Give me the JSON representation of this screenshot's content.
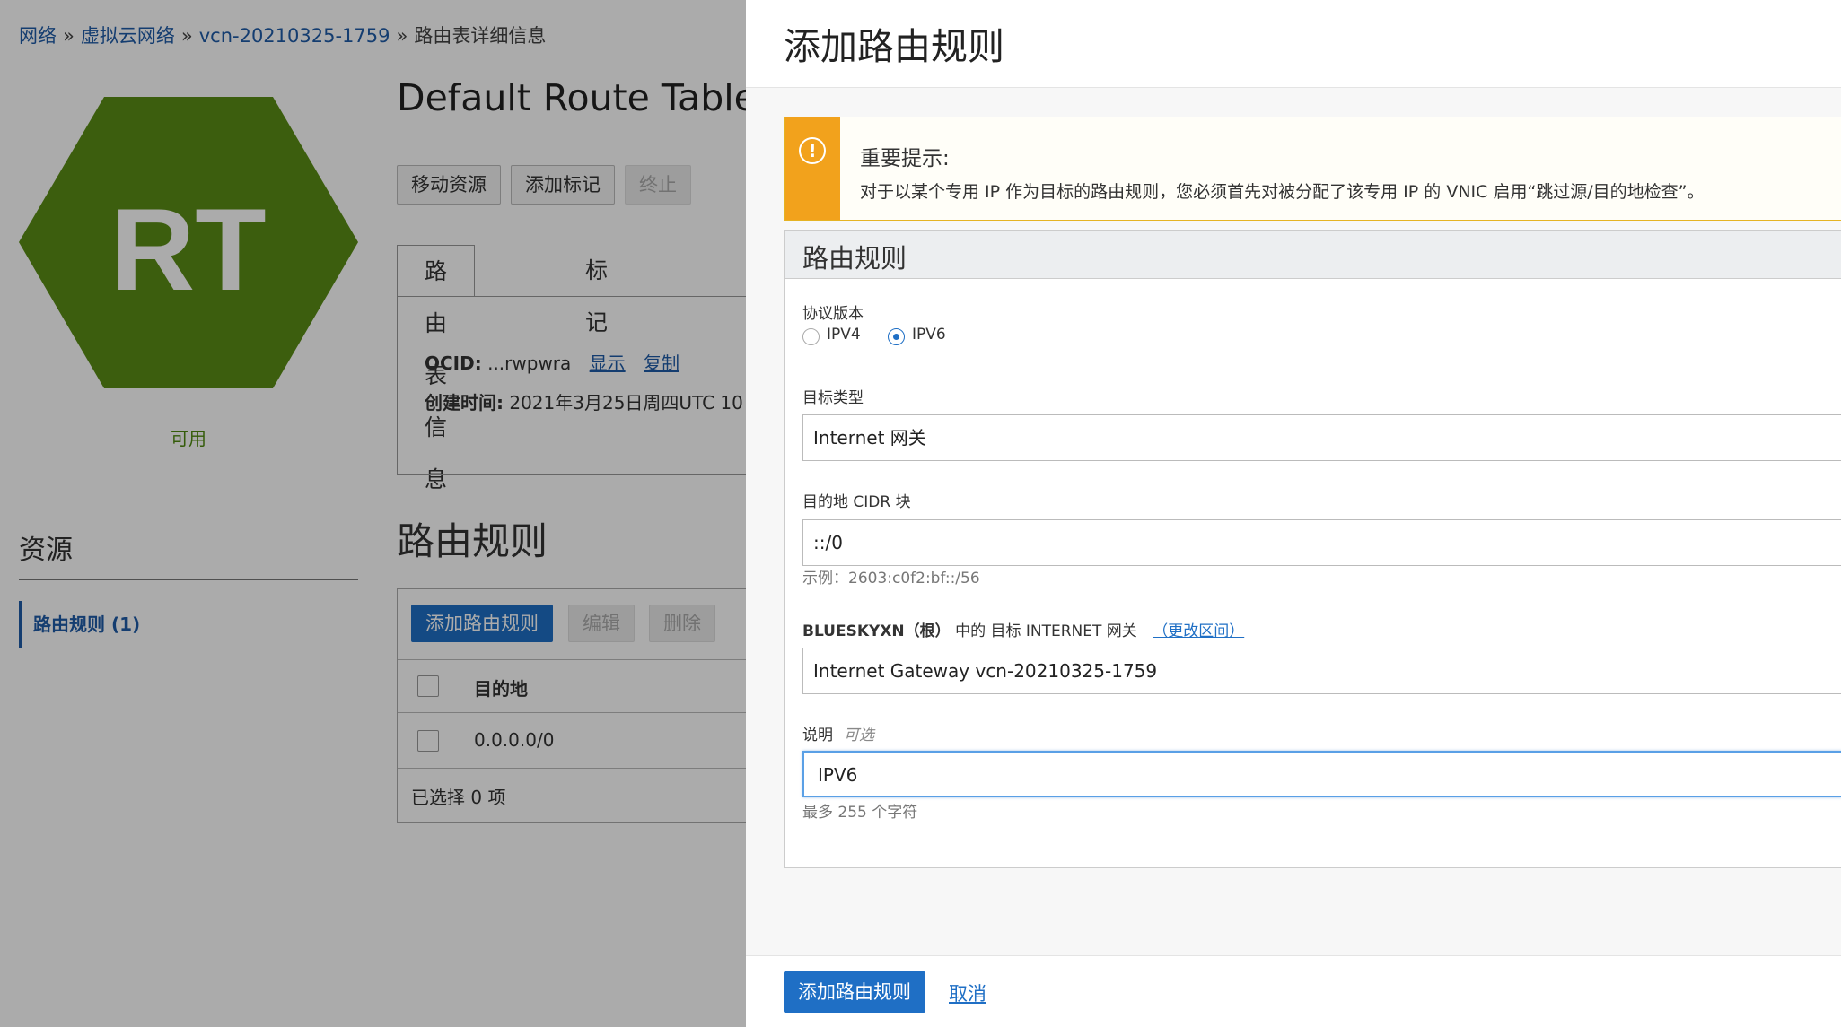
{
  "breadcrumb": {
    "items": [
      "网络",
      "虚拟云网络",
      "vcn-20210325-1759"
    ],
    "current": "路由表详细信息",
    "separator": "»"
  },
  "resource": {
    "icon_text": "RT",
    "icon_color": "#5a8c16",
    "status": "可用",
    "title": "Default Route Table f",
    "actions": [
      "移动资源",
      "添加标记",
      "终止"
    ],
    "tabs": [
      "路由表信息",
      "标记"
    ],
    "ocid_label": "OCID:",
    "ocid_value": "...rwpwra",
    "ocid_show": "显示",
    "ocid_copy": "复制",
    "created_label": "创建时间:",
    "created_value": "2021年3月25日周四UTC 10"
  },
  "sidebar": {
    "title": "资源",
    "items": [
      {
        "label": "路由规则 (1)"
      }
    ]
  },
  "rules": {
    "title": "路由规则",
    "add_label": "添加路由规则",
    "edit_label": "编辑",
    "delete_label": "删除",
    "column_destination": "目的地",
    "rows": [
      {
        "destination": "0.0.0.0/0"
      }
    ],
    "selected_text": "已选择 0 项"
  },
  "panel": {
    "title": "添加路由规则",
    "warning": {
      "title": "重要提示:",
      "text": "对于以某个专用 IP 作为目标的路由规则，您必须首先对被分配了该专用 IP 的 VNIC 启用“跳过源/目的地检查”。",
      "color": "#f2a21c"
    },
    "section_title": "路由规则",
    "protocol_label": "协议版本",
    "protocol_options": [
      "IPV4",
      "IPV6"
    ],
    "protocol_selected": "IPV6",
    "target_type_label": "目标类型",
    "target_type_value": "Internet 网关",
    "cidr_label": "目的地 CIDR 块",
    "cidr_value": "::/0",
    "cidr_example": "示例：2603:c0f2:bf::/56",
    "gateway_label_prefix": "BLUESKYXN（根）",
    "gateway_label_rest": "中的 目标 INTERNET 网关",
    "gateway_change": "（更改区间）",
    "gateway_value": "Internet Gateway vcn-20210325-1759",
    "desc_label": "说明",
    "desc_optional": "可选",
    "desc_value": "IPV6",
    "desc_hint": "最多 255 个字符",
    "submit_label": "添加路由规则",
    "cancel_label": "取消",
    "accent_color": "#1f6fc5"
  }
}
